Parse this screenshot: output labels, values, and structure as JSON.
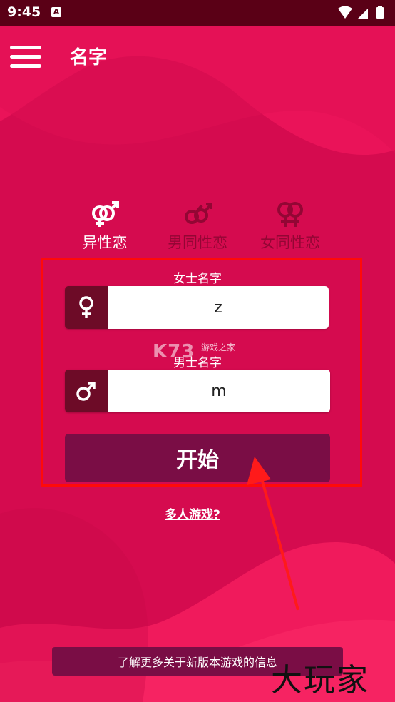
{
  "status_bar": {
    "time": "9:45",
    "notification_badge": "A"
  },
  "header": {
    "title": "名字",
    "menu_icon": "hamburger-menu-icon"
  },
  "tabs": [
    {
      "label": "异性恋",
      "icon": "hetero-symbol-icon",
      "selected": true
    },
    {
      "label": "男同性恋",
      "icon": "gay-symbol-icon",
      "selected": false
    },
    {
      "label": "女同性恋",
      "icon": "lesbian-symbol-icon",
      "selected": false
    }
  ],
  "form": {
    "female_label": "女士名字",
    "female_value": "z",
    "female_icon": "female-symbol-icon",
    "male_label": "男士名字",
    "male_value": "m",
    "male_icon": "male-symbol-icon",
    "start_label": "开始"
  },
  "multiplayer_link": "多人游戏?",
  "info_banner": "了解更多关于新版本游戏的信息",
  "watermarks": {
    "center_logo": "K73",
    "center_sub": "游戏之家",
    "corner": "大玩家"
  },
  "colors": {
    "background": "#d50b4f",
    "accent_dark": "#7a0d45",
    "icon_bg": "#6d0b27",
    "status_bar": "#5a0016",
    "highlight": "#ff0a0a"
  }
}
